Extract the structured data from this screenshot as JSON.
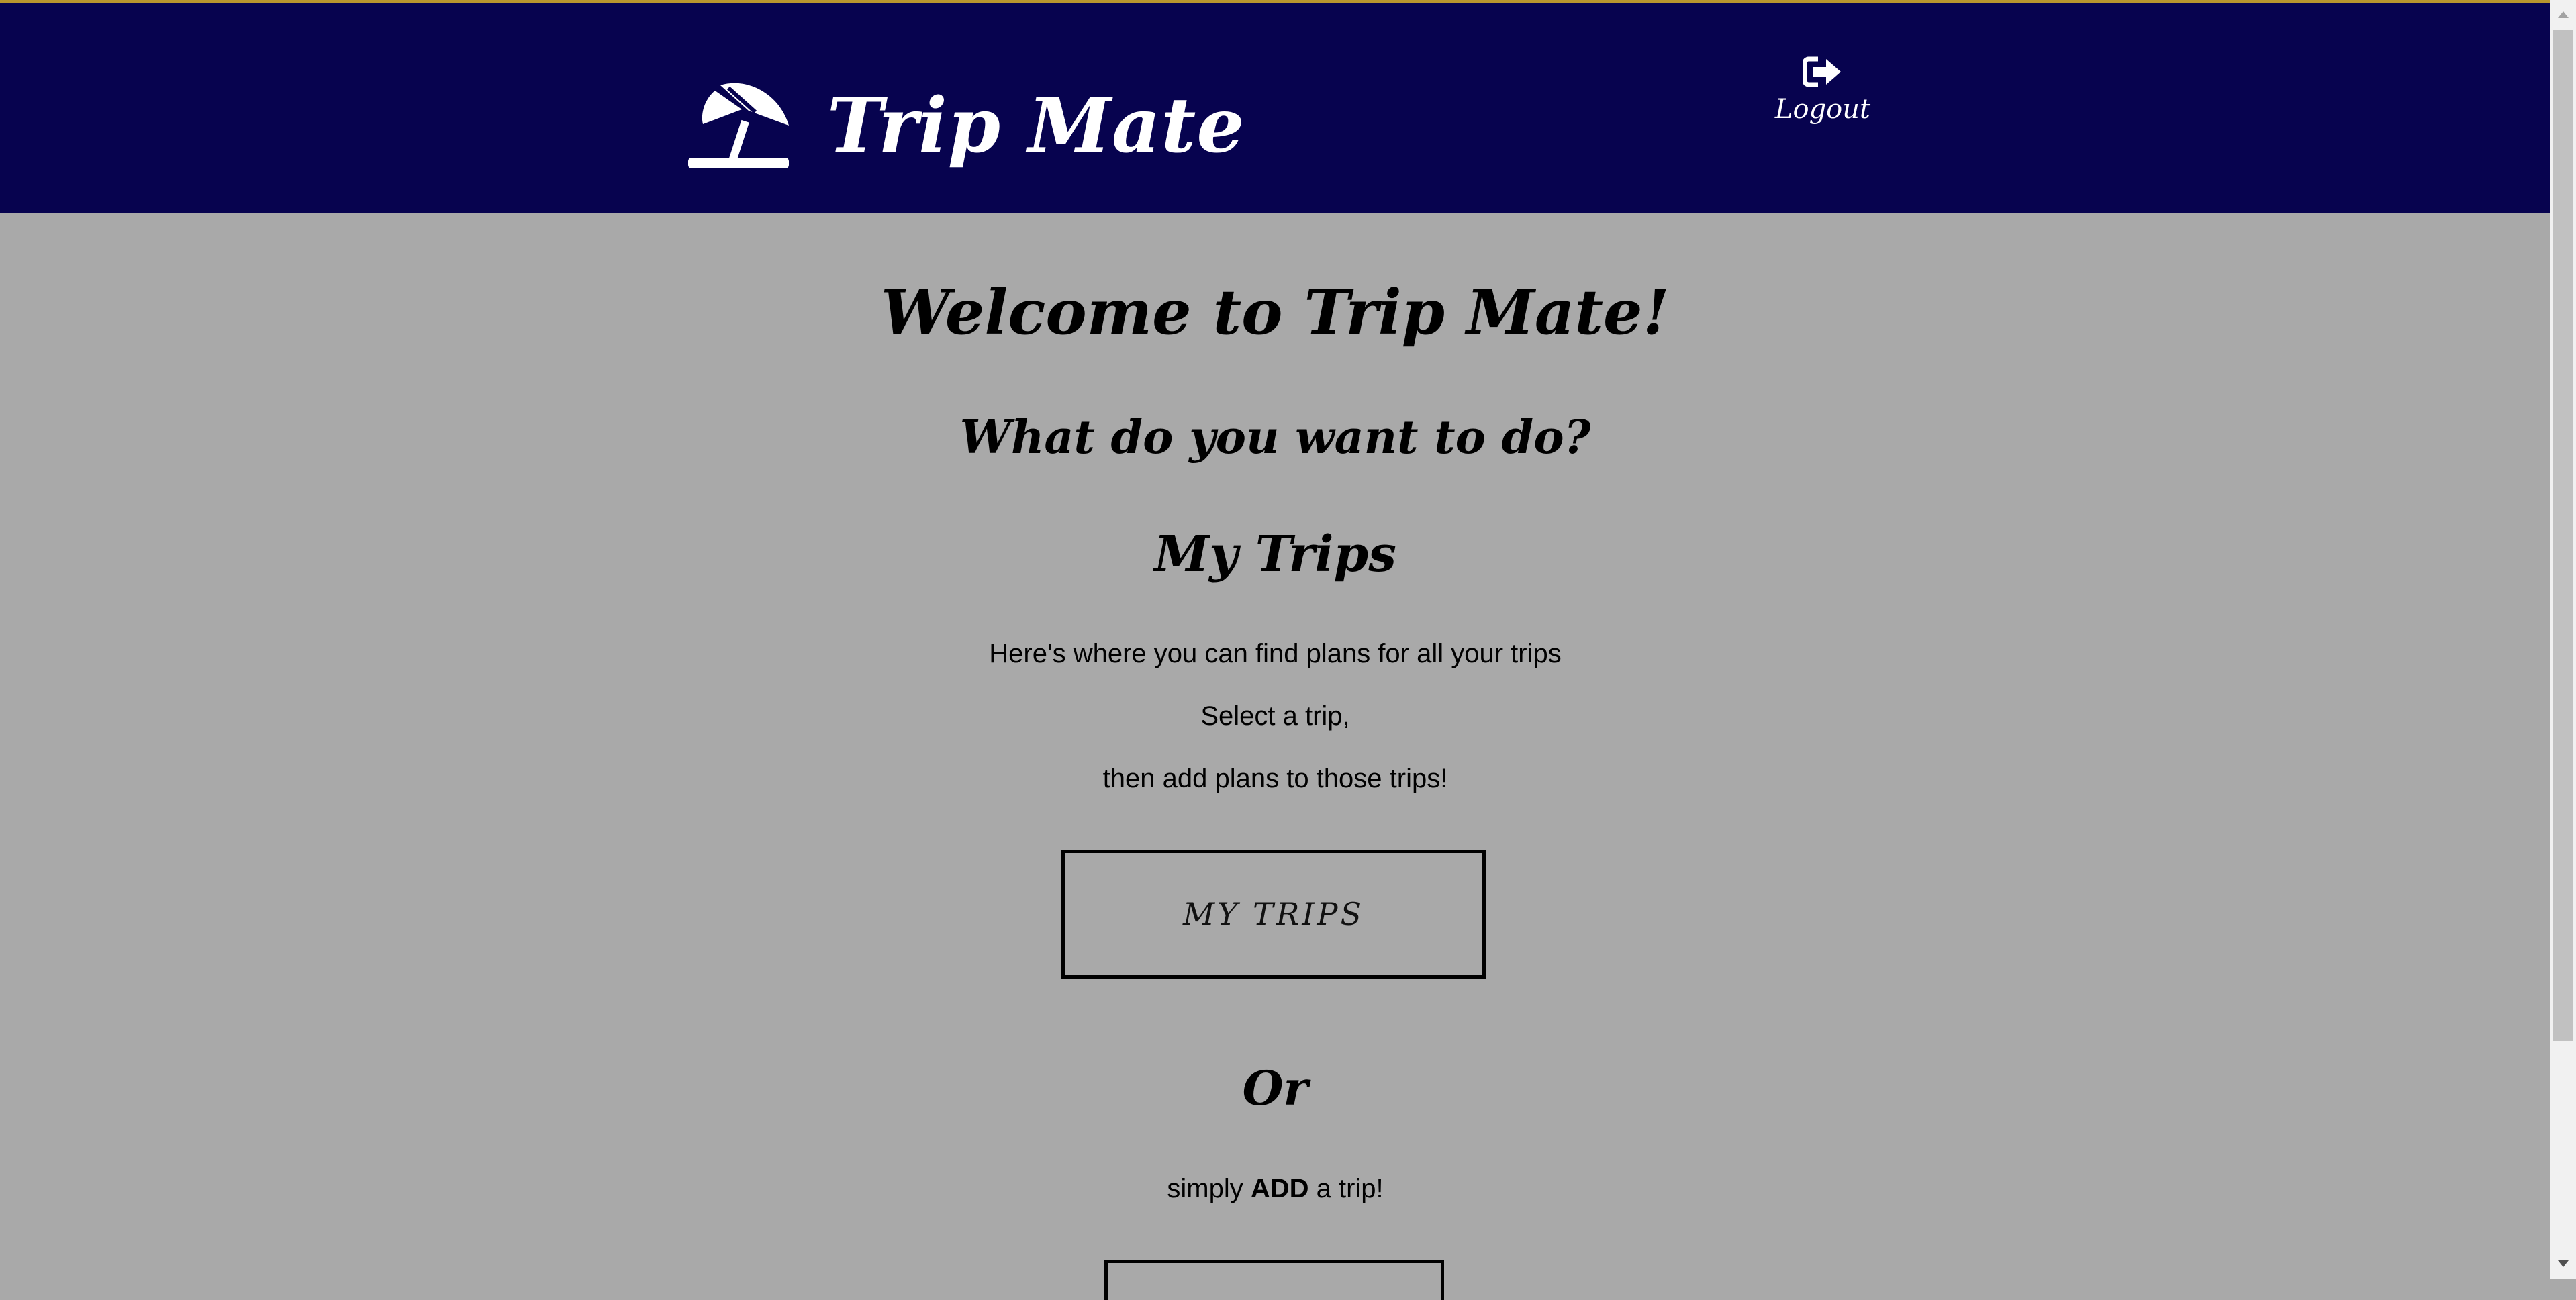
{
  "header": {
    "brand_title": "Trip Mate",
    "brand_icon": "beach-umbrella-icon",
    "logout_label": "Logout",
    "logout_icon": "sign-out-icon",
    "background_color": "#07034f"
  },
  "main": {
    "welcome": "Welcome to Trip Mate!",
    "question": "What do you want to do?",
    "my_trips_title": "My Trips",
    "my_trips_lines": [
      "Here's where you can find plans for all your trips",
      "Select a trip,",
      "then add plans to those trips!"
    ],
    "my_trips_button": "MY TRIPS",
    "or": "Or",
    "add_prefix": "simply ",
    "add_bold": "ADD",
    "add_suffix": " a trip!",
    "background_color": "#a9a9a9"
  }
}
